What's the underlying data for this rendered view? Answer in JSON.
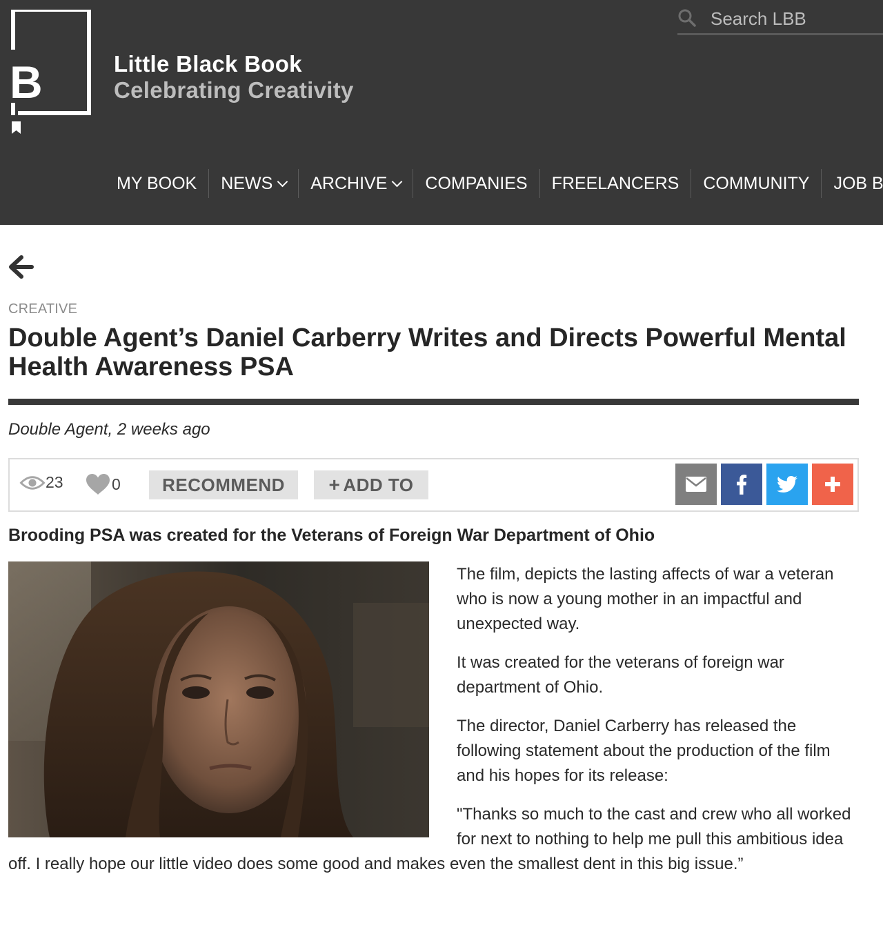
{
  "header": {
    "brand_name": "Little Black Book",
    "tagline": "Celebrating Creativity",
    "logo_letter": "B",
    "search_placeholder": "Search LBB",
    "nav": [
      {
        "label": "MY BOOK",
        "dropdown": false
      },
      {
        "label": "NEWS",
        "dropdown": true
      },
      {
        "label": "ARCHIVE",
        "dropdown": true
      },
      {
        "label": "COMPANIES",
        "dropdown": false
      },
      {
        "label": "FREELANCERS",
        "dropdown": false
      },
      {
        "label": "COMMUNITY",
        "dropdown": false
      },
      {
        "label": "JOB BOARD",
        "dropdown": false
      }
    ]
  },
  "article": {
    "category": "CREATIVE",
    "title": "Double Agent’s Daniel Carberry Writes and Directs Powerful Mental Health Awareness PSA",
    "byline": "Double Agent, 2 weeks ago",
    "views": "23",
    "likes": "0",
    "recommend_label": "RECOMMEND",
    "add_to_label": "ADD TO",
    "subtitle": "Brooding PSA was created for the Veterans of Foreign War Department of Ohio",
    "paragraphs": [
      "The film, depicts the lasting affects of war a veteran who is now a young mother in an impactful and unexpected way.",
      "It was created for the veterans of foreign war department of Ohio.",
      "The director, Daniel Carberry has released the following statement about the production of the film and his hopes for its release:",
      "\"Thanks so much to the cast and crew who all worked for next to nothing to help me pull this ambitious idea off. I really hope our little video does some good and makes even the smallest dent in this big issue.”"
    ]
  },
  "colors": {
    "header_bg": "#383838",
    "share_email": "#7f7f7f",
    "share_facebook": "#3b5998",
    "share_twitter": "#2aa3ef",
    "share_more": "#f0634a"
  },
  "icons": {
    "search": "search-icon",
    "back": "arrow-left-icon",
    "views": "eye-icon",
    "likes": "heart-icon",
    "email": "envelope-icon",
    "facebook": "facebook-icon",
    "twitter": "twitter-icon",
    "more": "plus-icon"
  }
}
